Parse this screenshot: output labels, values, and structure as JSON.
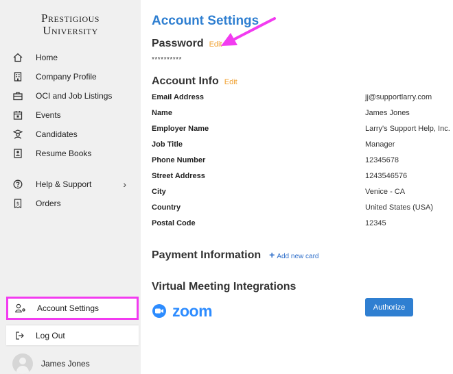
{
  "sidebar": {
    "logo_line1": "Prestigious",
    "logo_line2": "University",
    "items": [
      {
        "label": "Home",
        "icon": "home-icon"
      },
      {
        "label": "Company Profile",
        "icon": "building-icon"
      },
      {
        "label": "OCI and Job Listings",
        "icon": "briefcase-icon"
      },
      {
        "label": "Events",
        "icon": "calendar-icon"
      },
      {
        "label": "Candidates",
        "icon": "graduate-icon"
      },
      {
        "label": "Resume Books",
        "icon": "book-icon"
      },
      {
        "label": "Help & Support",
        "icon": "help-icon"
      },
      {
        "label": "Orders",
        "icon": "receipt-icon"
      }
    ],
    "account_settings": "Account Settings",
    "logout": "Log Out",
    "user_name": "James Jones"
  },
  "main": {
    "title": "Account Settings",
    "password": {
      "heading": "Password",
      "edit": "Edit",
      "masked": "**********"
    },
    "account_info": {
      "heading": "Account Info",
      "edit": "Edit",
      "rows": [
        {
          "label": "Email Address",
          "value": "jj@supportlarry.com"
        },
        {
          "label": "Name",
          "value": "James Jones"
        },
        {
          "label": "Employer Name",
          "value": "Larry's Support Help, Inc."
        },
        {
          "label": "Job Title",
          "value": "Manager"
        },
        {
          "label": "Phone Number",
          "value": "12345678"
        },
        {
          "label": "Street Address",
          "value": "1243546576"
        },
        {
          "label": "City",
          "value": "Venice - CA"
        },
        {
          "label": "Country",
          "value": "United States (USA)"
        },
        {
          "label": "Postal Code",
          "value": "12345"
        }
      ]
    },
    "payment": {
      "heading": "Payment Information",
      "add_card": "Add new card"
    },
    "meetings": {
      "heading": "Virtual Meeting Integrations",
      "zoom": "zoom",
      "authorize": "Authorize"
    }
  },
  "colors": {
    "accent": "#2f7fd1",
    "edit": "#f0a030",
    "highlight": "#f23bf0",
    "zoom": "#2d8cff"
  }
}
